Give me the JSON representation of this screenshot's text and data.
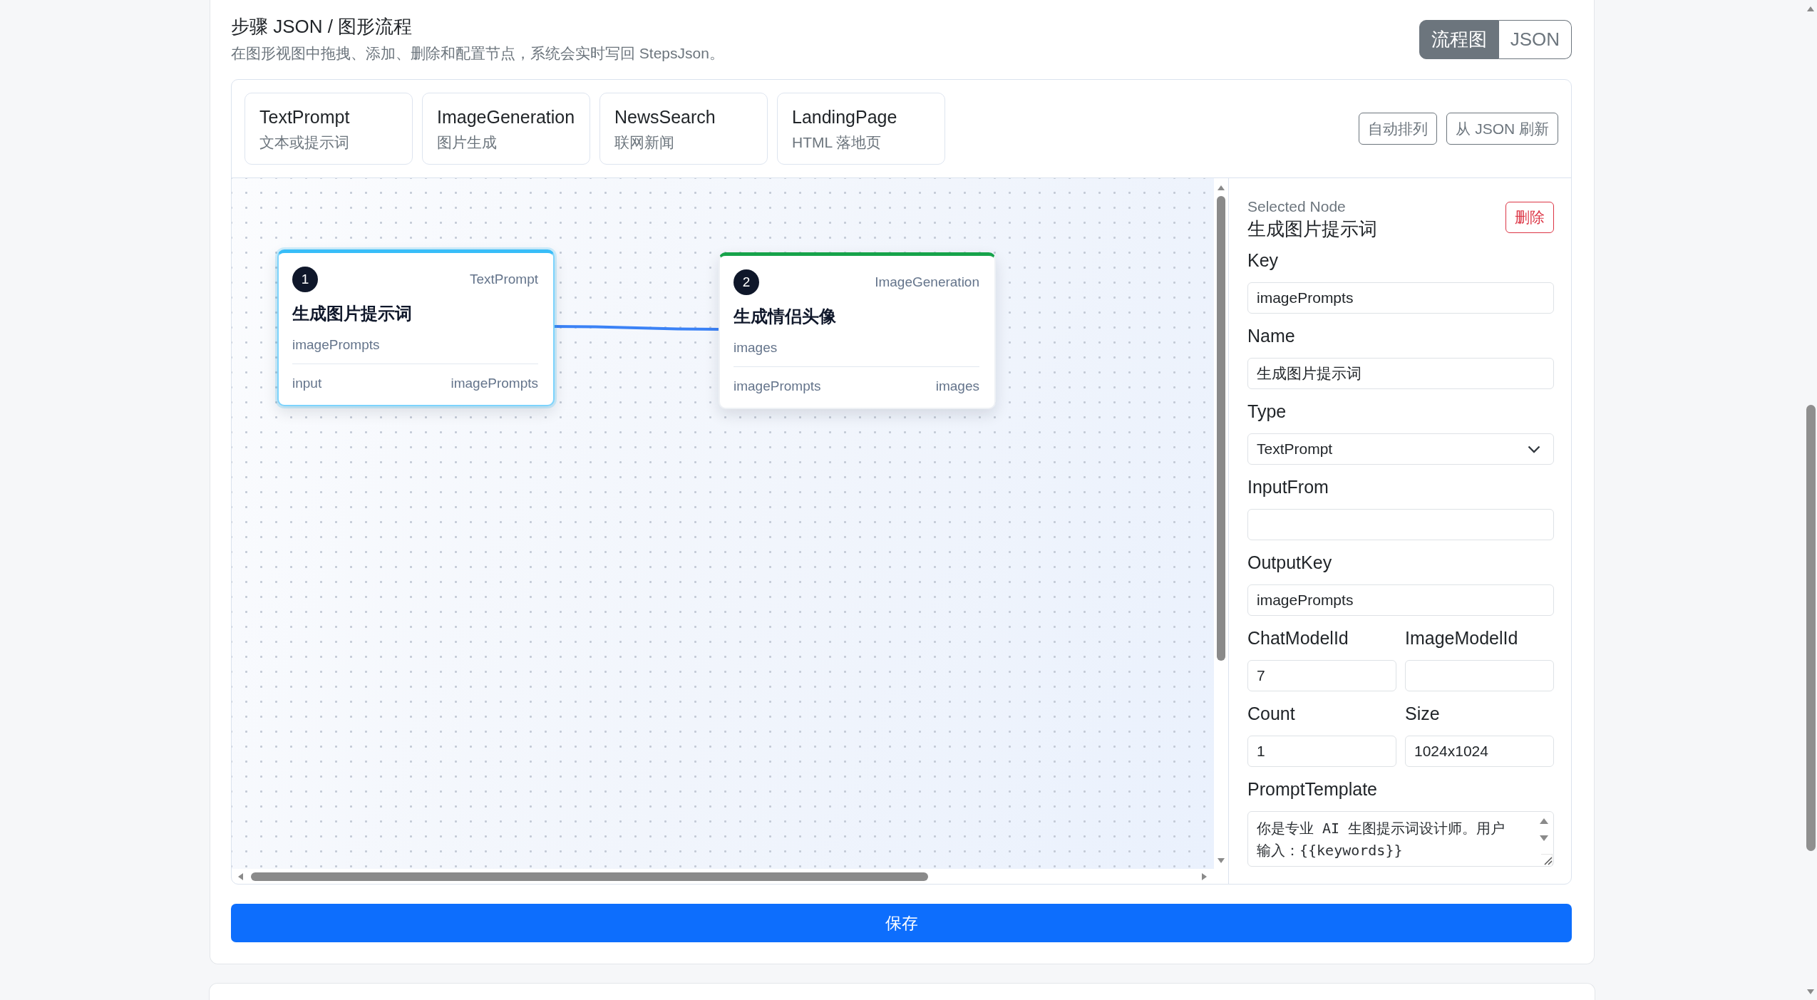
{
  "header": {
    "title": "步骤 JSON / 图形流程",
    "subtitle": "在图形视图中拖拽、添加、删除和配置节点，系统会实时写回 StepsJson。"
  },
  "view_tabs": [
    {
      "label": "流程图",
      "selected": true
    },
    {
      "label": "JSON",
      "selected": false
    }
  ],
  "palette": [
    {
      "title": "TextPrompt",
      "description": "文本或提示词"
    },
    {
      "title": "ImageGeneration",
      "description": "图片生成"
    },
    {
      "title": "NewsSearch",
      "description": "联网新闻"
    },
    {
      "title": "LandingPage",
      "description": "HTML 落地页"
    }
  ],
  "toolbar_buttons": [
    {
      "label": "自动排列"
    },
    {
      "label": "从 JSON 刷新"
    }
  ],
  "nodes": [
    {
      "number": "1",
      "type": "TextPrompt",
      "title": "生成图片提示词",
      "output_key": "imagePrompts",
      "port_in": "input",
      "port_out": "imagePrompts",
      "color": "#38bdf8",
      "selected": true,
      "connected": true
    },
    {
      "number": "2",
      "type": "ImageGeneration",
      "title": "生成情侣头像",
      "output_key": "images",
      "port_in": "imagePrompts",
      "port_out": "images",
      "color": "#16a34a",
      "selected": false,
      "connected": true
    }
  ],
  "inspector": {
    "caption": "Selected Node",
    "node_name": "生成图片提示词",
    "delete_button": "删除",
    "rows": [
      {
        "fields": [
          {
            "kind": "text",
            "label": "Key",
            "value": "imagePrompts"
          }
        ]
      },
      {
        "fields": [
          {
            "kind": "text",
            "label": "Name",
            "value": "生成图片提示词"
          }
        ]
      },
      {
        "fields": [
          {
            "kind": "select",
            "label": "Type",
            "value": "TextPrompt"
          }
        ]
      },
      {
        "fields": [
          {
            "kind": "text",
            "label": "InputFrom"
          }
        ]
      },
      {
        "fields": [
          {
            "kind": "text",
            "label": "OutputKey",
            "value": "imagePrompts"
          }
        ]
      },
      {
        "fields": [
          {
            "kind": "text",
            "label": "ChatModelId",
            "value": "7"
          },
          {
            "kind": "text",
            "label": "ImageModelId"
          }
        ]
      },
      {
        "fields": [
          {
            "kind": "text",
            "label": "Count",
            "value": "1"
          },
          {
            "kind": "text",
            "label": "Size",
            "value": "1024x1024"
          }
        ]
      },
      {
        "fields": [
          {
            "kind": "textarea",
            "label": "PromptTemplate",
            "value": "你是专业 AI 生图提示词设计师。用户输入：{{keywords}}"
          }
        ]
      }
    ]
  },
  "save_button": {
    "label": "保存"
  }
}
